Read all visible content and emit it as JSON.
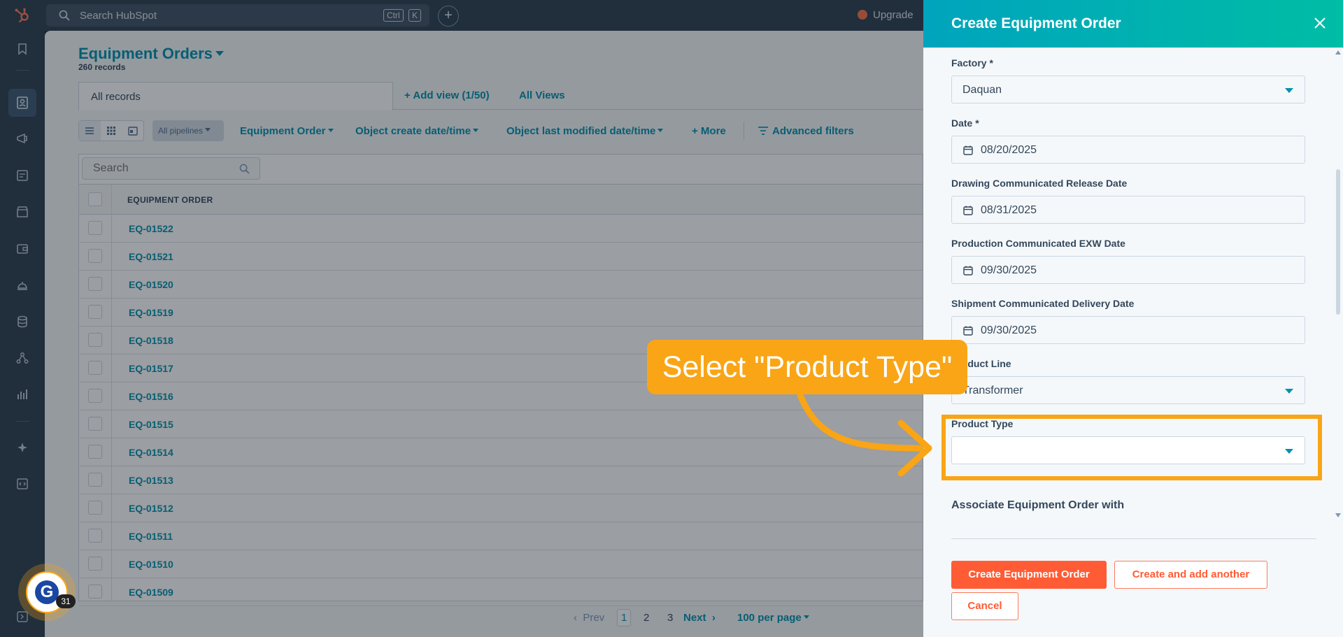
{
  "topbar": {
    "search_placeholder": "Search HubSpot",
    "shortcut_ctrl": "Ctrl",
    "shortcut_k": "K",
    "add_label": "+",
    "upgrade_label": "Upgrade"
  },
  "main": {
    "title": "Equipment Orders",
    "record_count": "260 records",
    "views": {
      "active": "All records",
      "add_view": "+ Add view (1/50)",
      "all_views": "All Views"
    },
    "filters": {
      "pipelines": "All pipelines",
      "equipment_order": "Equipment Order",
      "create_date": "Object create date/time",
      "modified_date": "Object last modified date/time",
      "more": "+ More",
      "advanced": "Advanced filters"
    },
    "table": {
      "search_placeholder": "Search",
      "column_header": "EQUIPMENT ORDER",
      "rows": [
        "EQ-01522",
        "EQ-01521",
        "EQ-01520",
        "EQ-01519",
        "EQ-01518",
        "EQ-01517",
        "EQ-01516",
        "EQ-01515",
        "EQ-01514",
        "EQ-01513",
        "EQ-01512",
        "EQ-01511",
        "EQ-01510",
        "EQ-01509"
      ]
    },
    "pagination": {
      "prev": "Prev",
      "pages": [
        "1",
        "2",
        "3"
      ],
      "current_page": "1",
      "next": "Next",
      "per_page": "100 per page"
    }
  },
  "panel": {
    "title": "Create Equipment Order",
    "fields": [
      {
        "label": "Factory *",
        "value": "Daquan",
        "kind": "dropdown"
      },
      {
        "label": "Date *",
        "value": "08/20/2025",
        "kind": "date"
      },
      {
        "label": "Drawing Communicated Release Date",
        "value": "08/31/2025",
        "kind": "date"
      },
      {
        "label": "Production Communicated EXW Date",
        "value": "09/30/2025",
        "kind": "date"
      },
      {
        "label": "Shipment Communicated Delivery Date",
        "value": "09/30/2025",
        "kind": "date"
      },
      {
        "label": "Product Line",
        "value": "Transformer",
        "kind": "dropdown"
      },
      {
        "label": "Product Type",
        "value": "",
        "kind": "dropdown"
      }
    ],
    "associate_heading": "Associate Equipment Order with",
    "buttons": {
      "create": "Create Equipment Order",
      "create_another": "Create and add another",
      "cancel": "Cancel"
    }
  },
  "callout": {
    "text": "Select \"Product Type\""
  },
  "badge": {
    "letter": "G",
    "count": "31"
  },
  "colors": {
    "accent": "#0091ae",
    "primary_button": "#ff5c35",
    "callout": "#f9a516",
    "header_gradient_start": "#00a4bd",
    "header_gradient_end": "#00bda5"
  }
}
